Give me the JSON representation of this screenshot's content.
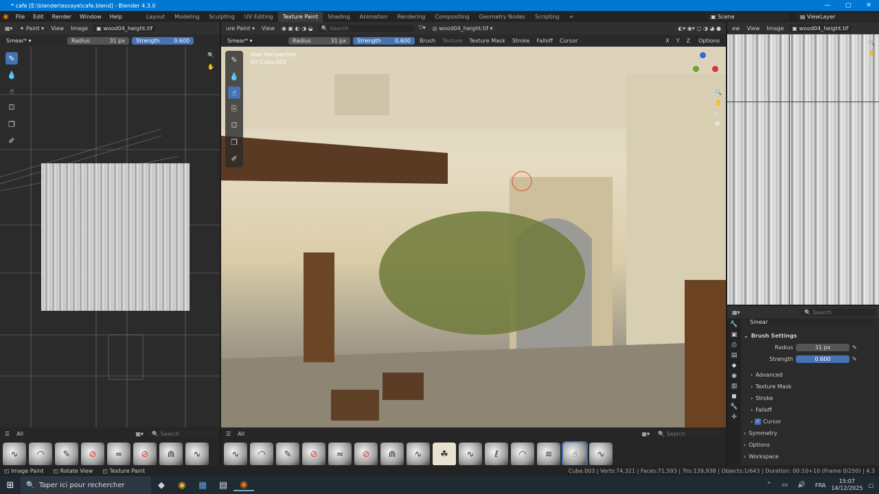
{
  "window": {
    "title": "* cafe [E:\\blender\\essaye\\cafe.blend] - Blender 4.3.0"
  },
  "menu": [
    "File",
    "Edit",
    "Render",
    "Window",
    "Help"
  ],
  "workspaces": [
    {
      "label": "Layout",
      "active": false
    },
    {
      "label": "Modeling",
      "active": false
    },
    {
      "label": "Sculpting",
      "active": false
    },
    {
      "label": "UV Editing",
      "active": false
    },
    {
      "label": "Texture Paint",
      "active": true
    },
    {
      "label": "Shading",
      "active": false
    },
    {
      "label": "Animation",
      "active": false
    },
    {
      "label": "Rendering",
      "active": false
    },
    {
      "label": "Compositing",
      "active": false
    },
    {
      "label": "Geometry Nodes",
      "active": false
    },
    {
      "label": "Scripting",
      "active": false
    }
  ],
  "add_workspace": "+",
  "scene": {
    "label": "Scene",
    "view_layer": "ViewLayer"
  },
  "left_editor": {
    "mode": "Paint",
    "view": "View",
    "image": "Image",
    "image_name": "wood04_height.tif",
    "brush": "Smear*",
    "radius_label": "Radius",
    "radius_value": "31 px",
    "strength_label": "Strength",
    "strength_value": "0.600",
    "asset_filter": "All",
    "search_placeholder": "Search"
  },
  "viewport": {
    "mode": "ure Paint",
    "view": "View",
    "search_placeholder": "Search",
    "image_name": "wood04_height.tif",
    "brush": "Smear*",
    "radius_label": "Radius",
    "radius_value": "31 px",
    "strength_label": "Strength",
    "strength_value": "0.600",
    "menus": [
      "Brush",
      "Texture",
      "Texture Mask",
      "Stroke",
      "Falloff",
      "Cursor"
    ],
    "axes": [
      "X",
      "Y",
      "Z"
    ],
    "options": "Options",
    "overlay_title": "User Perspective",
    "overlay_object": "(0) Cube.003",
    "asset_filter": "All",
    "search_placeholder2": "Search"
  },
  "image_editor": {
    "prefix": "ew",
    "view": "View",
    "image": "Image",
    "image_name": "wood04_height.tif"
  },
  "properties": {
    "search_placeholder": "Search",
    "brush_name": "Smear",
    "section": "Brush Settings",
    "radius_label": "Radius",
    "radius_value": "31 px",
    "strength_label": "Strength",
    "strength_value": "0.600",
    "subpanels": [
      "Advanced",
      "Texture Mask",
      "Stroke",
      "Falloff"
    ],
    "cursor_label": "Cursor",
    "cursor_checked": true,
    "panels": [
      "Symmetry",
      "Options",
      "Workspace"
    ]
  },
  "statusbar": {
    "hints": [
      "Image Paint",
      "Rotate View",
      "Texture Paint"
    ],
    "stats": "Cube.003 | Verts:74,321 | Faces:71,593 | Tris:139,938 | Objects:1/643 | Duration: 00:10+10 (Frame 0/250) | 4.3"
  },
  "taskbar": {
    "search_placeholder": "Taper ici pour rechercher",
    "lang": "FRA",
    "time": "15:07",
    "date": "14/12/2025"
  },
  "colors": {
    "accent": "#4772b3",
    "titlebar": "#0078d4"
  }
}
